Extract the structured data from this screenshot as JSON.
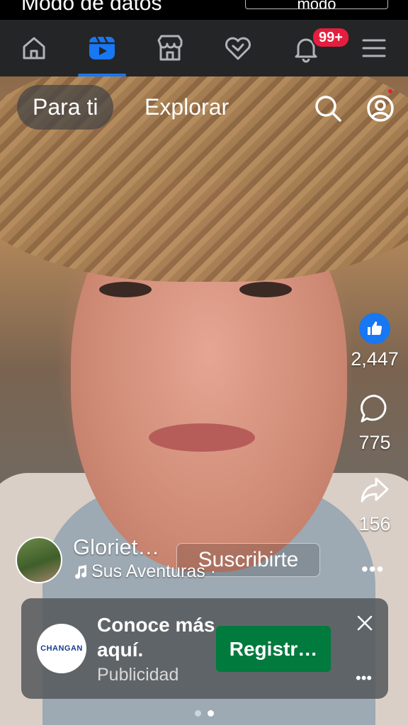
{
  "status_bar": {
    "mode_text": "Modo de datos",
    "pill_text": "modo"
  },
  "nav": {
    "items": [
      {
        "icon": "home-icon"
      },
      {
        "icon": "reels-icon",
        "active": true
      },
      {
        "icon": "marketplace-icon"
      },
      {
        "icon": "dating-heart-icon"
      },
      {
        "icon": "bell-icon",
        "badge": "99+"
      },
      {
        "icon": "menu-icon"
      }
    ]
  },
  "reels_header": {
    "tab_active": "Para ti",
    "tab_other": "Explorar",
    "icons": [
      "search-icon",
      "profile-icon"
    ]
  },
  "actions": {
    "likes": "2,447",
    "comments": "775",
    "shares": "156"
  },
  "author": {
    "name": "Gloriet…",
    "subscribe_label": "Suscribirte",
    "audio": "Sus Aventuras ·"
  },
  "ad": {
    "brand_logo": "CHANGAN",
    "title": "Conoce más aquí.",
    "sponsored_label": "Publicidad",
    "cta_label": "Registr…"
  },
  "colors": {
    "accent": "#1877f2",
    "badge": "#e41e3f",
    "cta": "#007a3d",
    "nav_bg": "#242526"
  }
}
